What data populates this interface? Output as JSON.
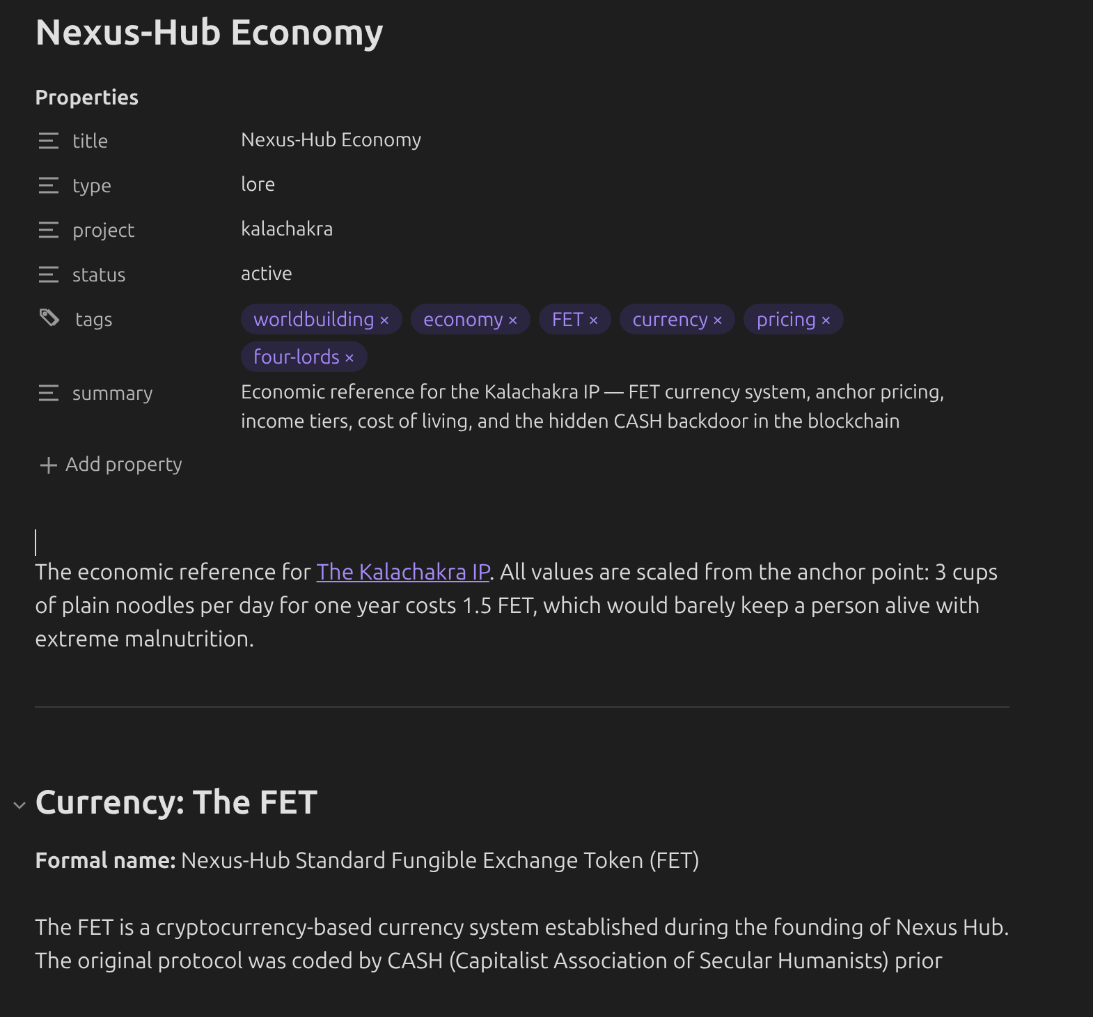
{
  "note_title": "Nexus-Hub Economy",
  "properties": {
    "heading": "Properties",
    "items": [
      {
        "kind": "text",
        "key": "title",
        "value": "Nexus-Hub Economy"
      },
      {
        "kind": "text",
        "key": "type",
        "value": "lore"
      },
      {
        "kind": "text",
        "key": "project",
        "value": "kalachakra"
      },
      {
        "kind": "text",
        "key": "status",
        "value": "active"
      },
      {
        "kind": "tags",
        "key": "tags",
        "tags": [
          {
            "label": "worldbuilding",
            "remove": "×"
          },
          {
            "label": "economy",
            "remove": "×"
          },
          {
            "label": "FET",
            "remove": "×"
          },
          {
            "label": "currency",
            "remove": "×"
          },
          {
            "label": "pricing",
            "remove": "×"
          },
          {
            "label": "four-lords",
            "remove": "×"
          }
        ]
      },
      {
        "kind": "text",
        "key": "summary",
        "value": "Economic reference for the Kalachakra IP — FET currency system, anchor pricing, income tiers, cost of living, and the hidden CASH backdoor in the blockchain"
      }
    ],
    "add": "Add property"
  },
  "intro": [
    {
      "kind": "text",
      "text": "The economic reference for "
    },
    {
      "kind": "link",
      "text": "The Kalachakra IP"
    },
    {
      "kind": "text",
      "text": ". All values are scaled from the anchor point: 3 cups of plain noodles per day for one year costs 1.5 FET, which would barely keep a person alive with extreme malnutrition."
    }
  ],
  "section": {
    "heading": "Currency: The FET",
    "expanded": true,
    "paragraphs": [
      "**Formal name:** Nexus-Hub Standard Fungible Exchange Token (FET)",
      "The FET is a cryptocurrency-based currency system established during the founding of Nexus Hub. The original protocol was coded by CASH (Capitalist Association of Secular Humanists) prior"
    ]
  }
}
